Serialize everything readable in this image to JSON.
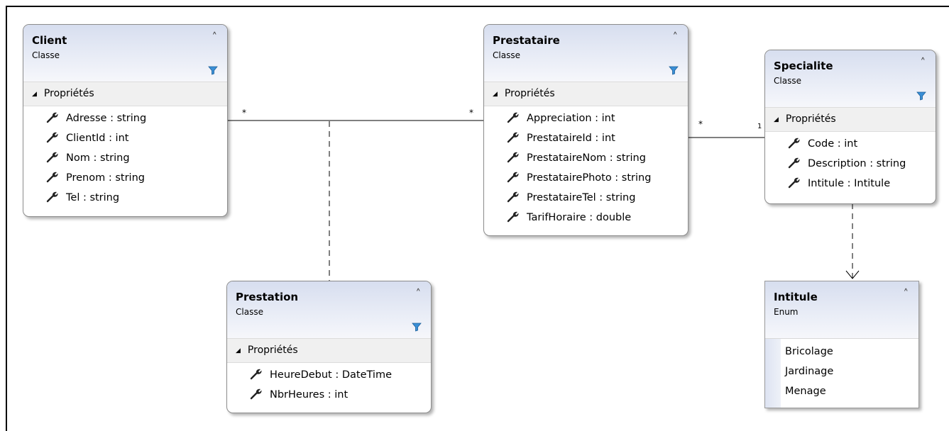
{
  "classes": {
    "client": {
      "name": "Client",
      "kind": "Classe",
      "section": "Propriétés",
      "props": [
        "Adresse : string",
        "ClientId : int",
        "Nom : string",
        "Prenom : string",
        "Tel : string"
      ]
    },
    "prestataire": {
      "name": "Prestataire",
      "kind": "Classe",
      "section": "Propriétés",
      "props": [
        "Appreciation : int",
        "PrestataireId : int",
        "PrestataireNom : string",
        "PrestatairePhoto : string",
        "PrestataireTel : string",
        "TarifHoraire : double"
      ]
    },
    "specialite": {
      "name": "Specialite",
      "kind": "Classe",
      "section": "Propriétés",
      "props": [
        "Code : int",
        "Description : string",
        "Intitule : Intitule"
      ]
    },
    "prestation": {
      "name": "Prestation",
      "kind": "Classe",
      "section": "Propriétés",
      "props": [
        "HeureDebut : DateTime",
        "NbrHeures : int"
      ]
    }
  },
  "enums": {
    "intitule": {
      "name": "Intitule",
      "kind": "Enum",
      "values": [
        "Bricolage",
        "Jardinage",
        "Menage"
      ]
    }
  },
  "multiplicities": {
    "client_side": "*",
    "prestataire_left": "*",
    "prestataire_right": "*",
    "specialite_left": "1"
  },
  "icons": {
    "collapse": "double-chevron-up-icon",
    "filter": "filter-icon",
    "expander": "triangle-down-icon",
    "property": "wrench-icon"
  },
  "colors": {
    "header_top": "#d7deef",
    "filter_blue": "#3a8fd6",
    "line": "#000000"
  }
}
